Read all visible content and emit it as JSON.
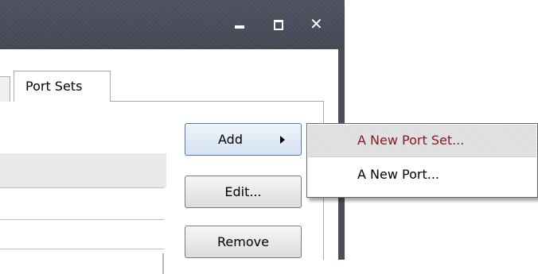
{
  "window": {
    "minimize_icon": "minimize-icon",
    "maximize_icon": "maximize-icon",
    "close_glyph": "✕"
  },
  "tabs": [
    {
      "label": "Port Sets",
      "selected": true
    }
  ],
  "buttons": {
    "add_label": "Add",
    "edit_label": "Edit...",
    "remove_label": "Remove"
  },
  "add_menu": {
    "items": [
      {
        "label": "A New Port Set...",
        "highlighted": true
      },
      {
        "label": "A New Port...",
        "highlighted": false
      }
    ]
  },
  "colors": {
    "titlebar": "#4a4e5a",
    "highlight_text": "#8b1a22"
  }
}
